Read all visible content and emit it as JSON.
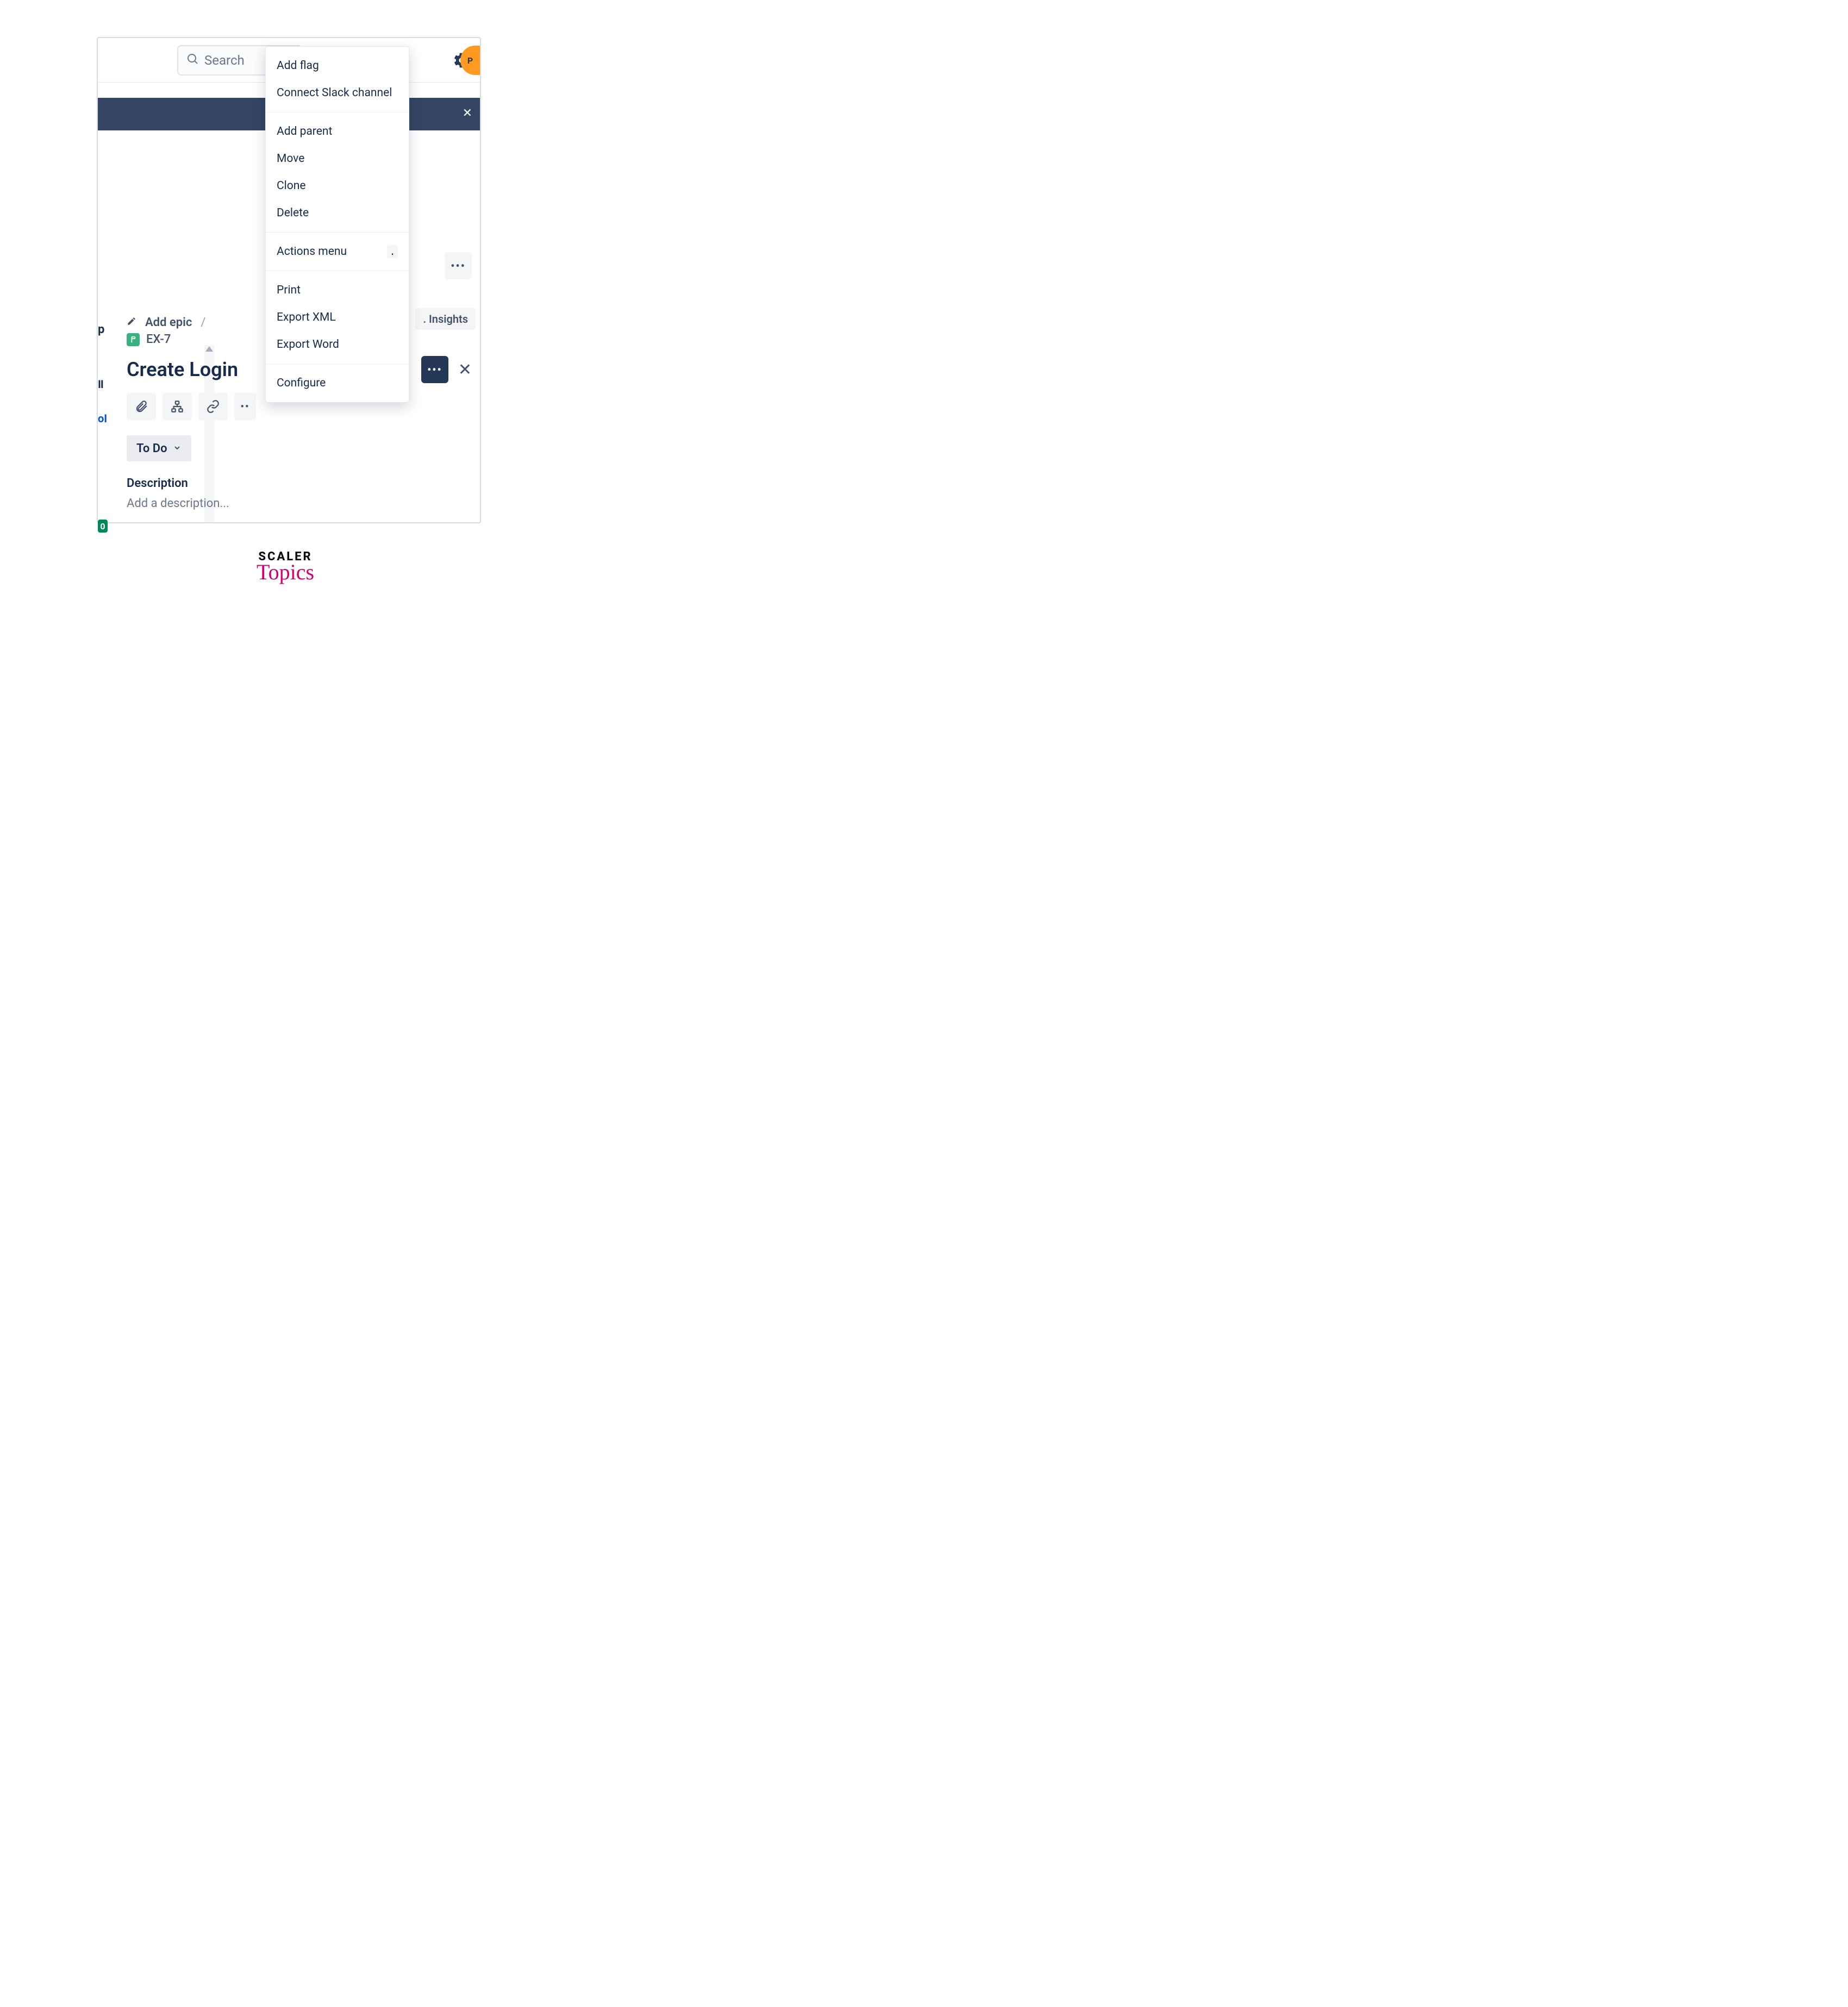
{
  "search": {
    "placeholder": "Search"
  },
  "avatar": {
    "initial": "P"
  },
  "breadcrumb": {
    "add_epic": "Add epic",
    "slash": "/"
  },
  "issue": {
    "key": "EX-7",
    "title": "Create Login",
    "status": "To Do",
    "description_label": "Description",
    "description_placeholder": "Add a description..."
  },
  "insights": {
    "label": "Insights",
    "prefix": "."
  },
  "dropdown": {
    "section1": [
      "Add flag",
      "Connect Slack channel"
    ],
    "section2": [
      "Add parent",
      "Move",
      "Clone",
      "Delete"
    ],
    "actions_label": "Actions menu",
    "actions_key": ".",
    "section4": [
      "Print",
      "Export XML",
      "Export Word"
    ],
    "section5": [
      "Configure"
    ]
  },
  "left_peeks": {
    "p": "p",
    "bar1": "I",
    "oi": "oI",
    "zero": "0"
  },
  "brand": {
    "line1": "SCALER",
    "line2": "Topics"
  }
}
